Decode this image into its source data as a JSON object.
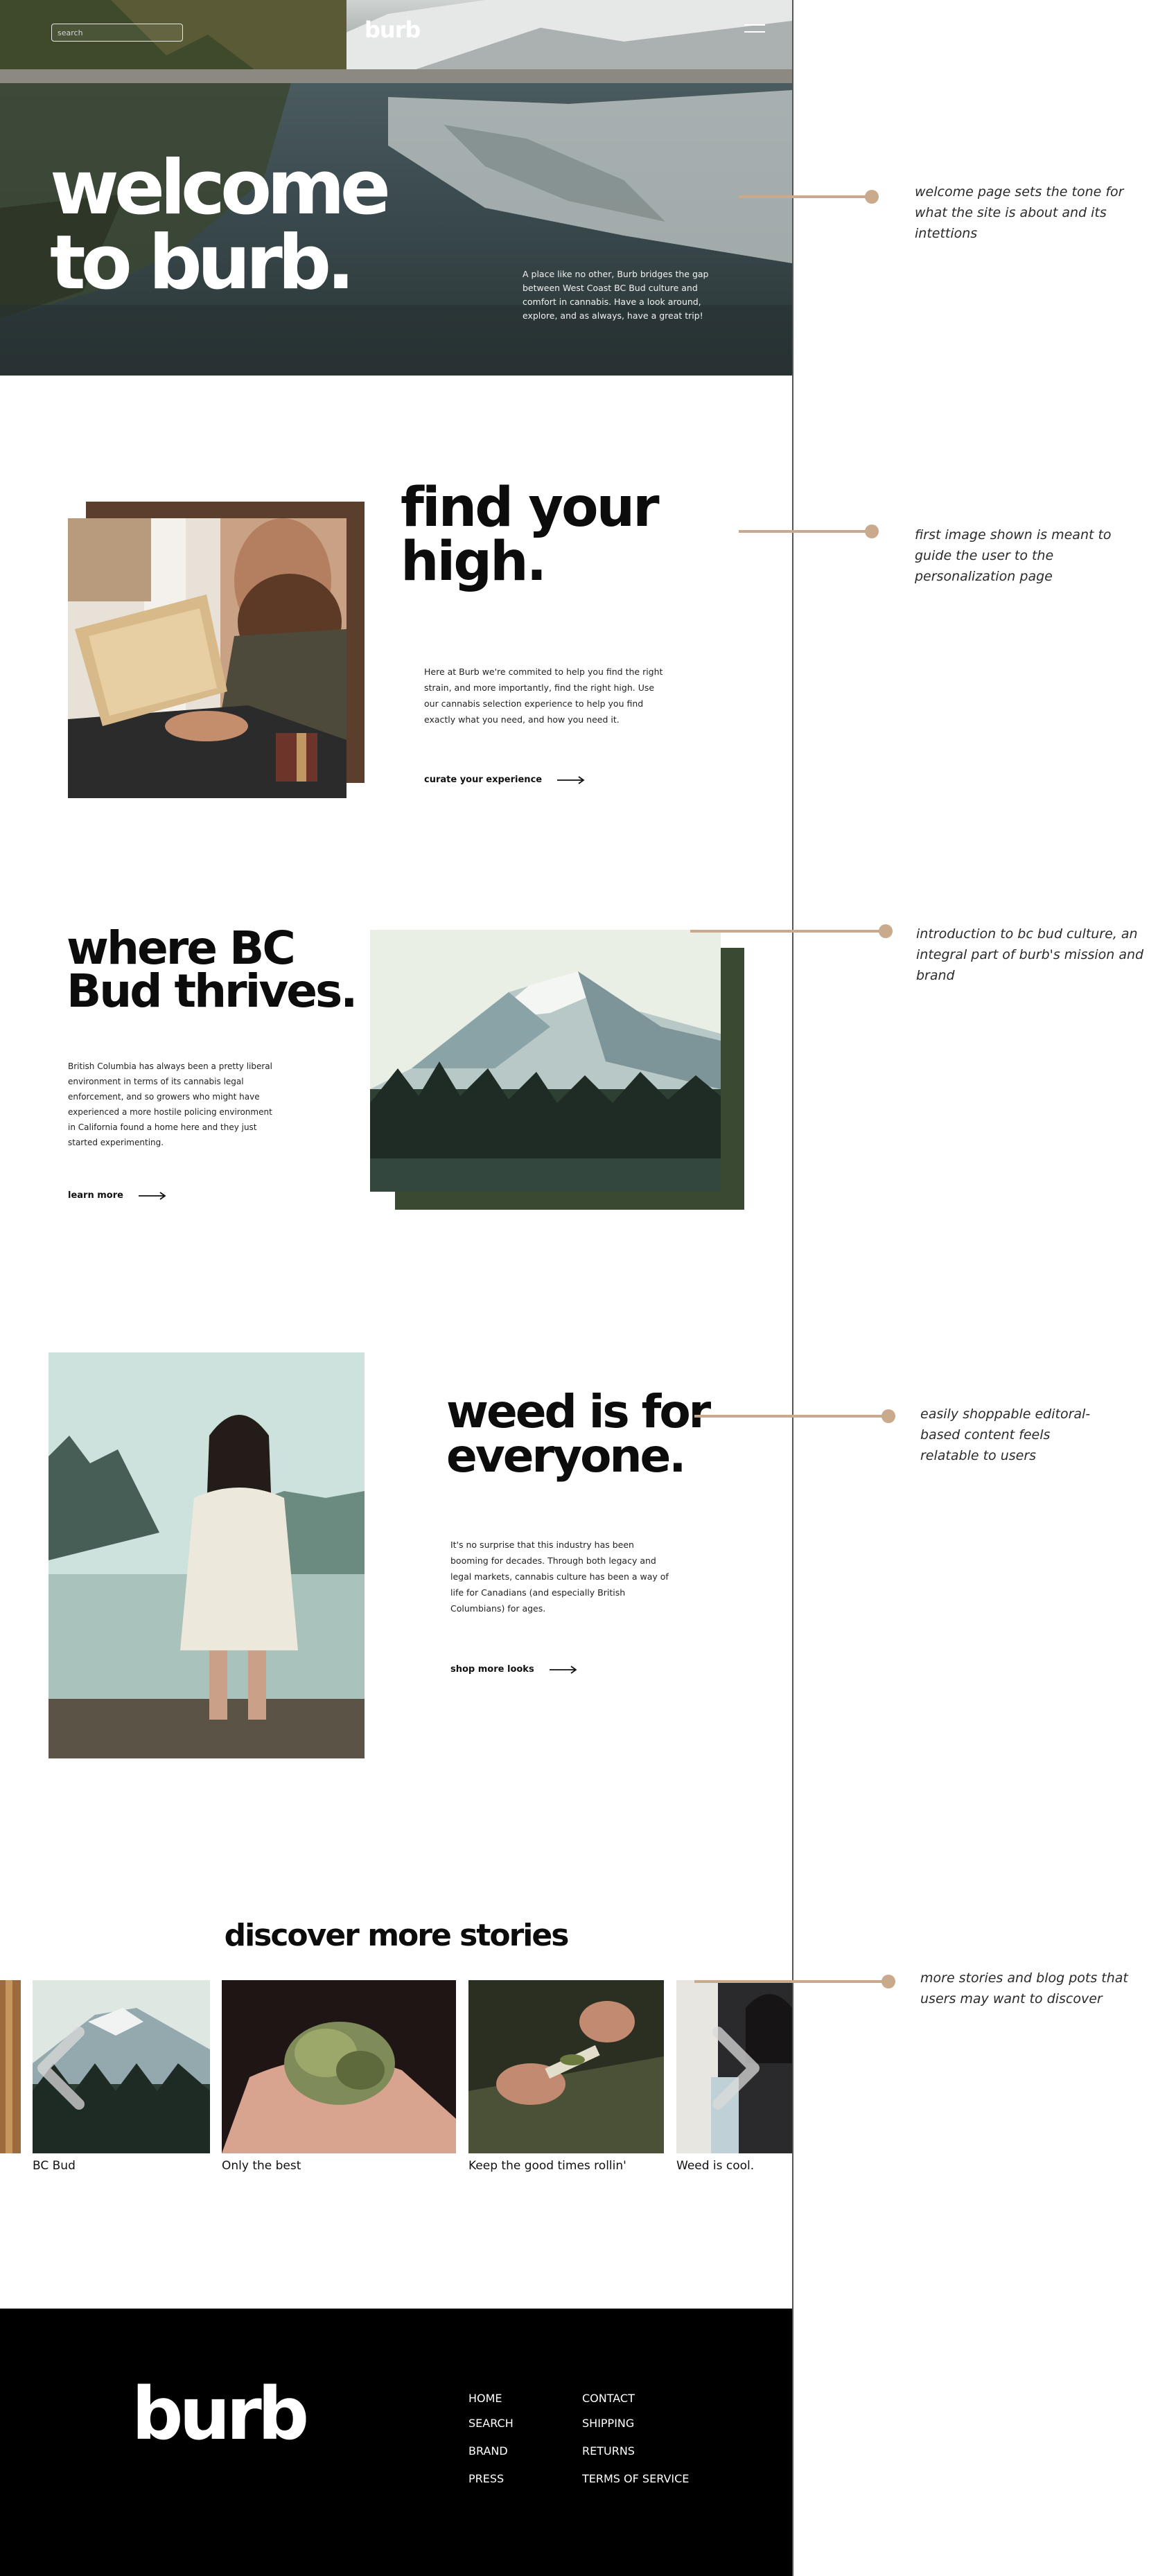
{
  "header": {
    "search_placeholder": "search",
    "logo": "burb"
  },
  "hero": {
    "title_line1": "welcome",
    "title_line2": "to burb.",
    "text": "A place like no other, Burb bridges the gap between West Coast BC Bud culture and comfort in cannabis. Have a look around, explore, and as always, have a great trip!"
  },
  "find_high": {
    "title_line1": "find your",
    "title_line2": "high.",
    "text": "Here at Burb we're commited to help you find the right strain, and more importantly, find the right high. Use our cannabis selection experience to help you find exactly what you need, and how you need it.",
    "cta": "curate your experience"
  },
  "bc_bud": {
    "title_line1": "where BC",
    "title_line2": "Bud thrives.",
    "text": "British Columbia has always been a pretty liberal environment in terms of its cannabis legal enforcement, and so growers who might have experienced a more hostile policing environment in California found a home here and they just started experimenting.",
    "cta": "learn more"
  },
  "everyone": {
    "title_line1": "weed is for",
    "title_line2": "everyone.",
    "text": "It's no surprise that this industry has been booming for decades. Through both legacy and legal markets, cannabis culture has been a way of life for Canadians (and especially British Columbians) for ages.",
    "cta": "shop more looks"
  },
  "stories": {
    "title": "discover more stories",
    "items": [
      {
        "caption": "BC Bud"
      },
      {
        "caption": "Only the best"
      },
      {
        "caption": "Keep the good times rollin'"
      },
      {
        "caption": "Weed is cool."
      }
    ]
  },
  "footer": {
    "logo": "burb",
    "col1": [
      "HOME",
      "SEARCH",
      "BRAND",
      "PRESS"
    ],
    "col2": [
      "CONTACT",
      "SHIPPING",
      "RETURNS",
      "TERMS OF SERVICE"
    ]
  },
  "annotations": [
    "welcome page sets the tone for what the site is about and its intettions",
    "first image shown is meant to guide the user to the personalization page",
    "introduction to bc bud culture, an integral part of burb's mission and brand",
    "easily shoppable editoral-based content feels relatable to users",
    "more stories and blog pots that users may want to discover"
  ],
  "colors": {
    "accent": "#c9aa8d",
    "footer_bg": "#000000",
    "text": "#0c0c0c"
  },
  "icons": [
    "menu-icon",
    "arrow-right-icon",
    "chevron-left-icon",
    "chevron-right-icon"
  ]
}
